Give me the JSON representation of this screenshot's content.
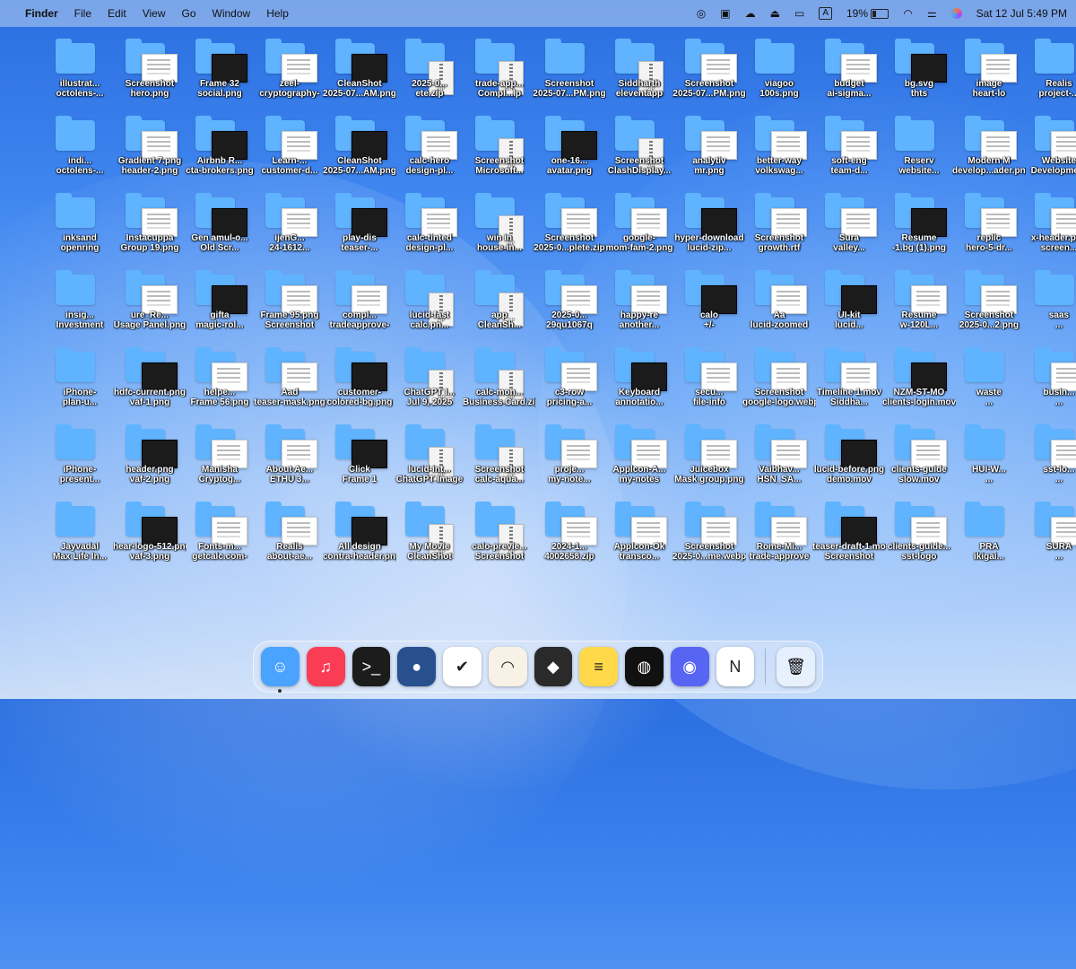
{
  "menubar": {
    "apple": "",
    "app": "Finder",
    "items": [
      "File",
      "Edit",
      "View",
      "Go",
      "Window",
      "Help"
    ],
    "battery": "19%",
    "input": "A",
    "datetime": "Sat 12 Jul  5:49 PM"
  },
  "desktop": {
    "items": [
      {
        "t": "folder",
        "l": "illustrat...",
        "l2": "octolens-..."
      },
      {
        "t": "doc",
        "l": "Screenshot",
        "l2": "hero.png"
      },
      {
        "t": "dark",
        "l": "Frame 32",
        "l2": "social.png"
      },
      {
        "t": "doc",
        "l": "zeel-",
        "l2": "cryptography-"
      },
      {
        "t": "dark",
        "l": "CleanShot",
        "l2": "2025-07...AM.png"
      },
      {
        "t": "zip",
        "l": "2025-0...",
        "l2": "ete.zip"
      },
      {
        "t": "zip",
        "l": "trade-app...",
        "l2": "Compl...ip"
      },
      {
        "t": "folder",
        "l": "Screenshot",
        "l2": "2025-07...PM.png"
      },
      {
        "t": "zip",
        "l": "Siddharth",
        "l2": "eleventapp"
      },
      {
        "t": "doc",
        "l": "Screenshot",
        "l2": "2025-07...PM.png"
      },
      {
        "t": "folder",
        "l": "viagoo",
        "l2": "100s.png"
      },
      {
        "t": "doc",
        "l": "budget",
        "l2": "ai-sigma..."
      },
      {
        "t": "dark",
        "l": "bg.svg",
        "l2": "thts"
      },
      {
        "t": "doc",
        "l": "image",
        "l2": "heart-lo"
      },
      {
        "t": "folder",
        "l": "Realis",
        "l2": "project-..."
      },
      {
        "t": "folder",
        "l": "indi...",
        "l2": "octolens-..."
      },
      {
        "t": "doc",
        "l": "Gradient 7.png",
        "l2": "header-2.png"
      },
      {
        "t": "dark",
        "l": "Airbnb R...",
        "l2": "cta-brokers.png"
      },
      {
        "t": "doc",
        "l": "Learn-...",
        "l2": "customer-d..."
      },
      {
        "t": "dark",
        "l": "CleanShot",
        "l2": "2025-07...AM.png"
      },
      {
        "t": "doc",
        "l": "calc-hero",
        "l2": "design-pl..."
      },
      {
        "t": "zip",
        "l": "Screenshot",
        "l2": "Microsoft..."
      },
      {
        "t": "dark",
        "l": "one-16...",
        "l2": "avatar.png"
      },
      {
        "t": "zip",
        "l": "Screenshot",
        "l2": "ClashDisplay..."
      },
      {
        "t": "doc",
        "l": "analytiv",
        "l2": "mr.png"
      },
      {
        "t": "doc",
        "l": "better-way",
        "l2": "volkswag..."
      },
      {
        "t": "doc",
        "l": "soft-eng",
        "l2": "team-d..."
      },
      {
        "t": "folder",
        "l": "Reserv",
        "l2": "website..."
      },
      {
        "t": "doc",
        "l": "Modern M",
        "l2": "develop...ader.png"
      },
      {
        "t": "doc",
        "l": "Website",
        "l2": "Development"
      },
      {
        "t": "folder",
        "l": "inksand",
        "l2": "openring"
      },
      {
        "t": "doc",
        "l": "Instacuppa",
        "l2": "Group 19.png"
      },
      {
        "t": "dark",
        "l": "Gen amul-o...",
        "l2": "Old Scr..."
      },
      {
        "t": "doc",
        "l": "ijenG...",
        "l2": "24-1612..."
      },
      {
        "t": "dark",
        "l": "play-dis",
        "l2": "teaser-..."
      },
      {
        "t": "doc",
        "l": "calc-tinted",
        "l2": "design-pl..."
      },
      {
        "t": "zip",
        "l": "win in",
        "l2": "house-in..."
      },
      {
        "t": "doc",
        "l": "Screenshot",
        "l2": "2025-0...plete.zip"
      },
      {
        "t": "doc",
        "l": "google-",
        "l2": "mom-fam-2.png"
      },
      {
        "t": "dark",
        "l": "hyper-download",
        "l2": "lucid-zip..."
      },
      {
        "t": "doc",
        "l": "Screenshot",
        "l2": "growth.rtf"
      },
      {
        "t": "doc",
        "l": "Sura",
        "l2": "valley..."
      },
      {
        "t": "dark",
        "l": "Resume",
        "l2": "-1.bg (1).png"
      },
      {
        "t": "doc",
        "l": "replic",
        "l2": "hero-5-dr..."
      },
      {
        "t": "doc",
        "l": "x-header.png",
        "l2": "screen..."
      },
      {
        "t": "folder",
        "l": "insig...",
        "l2": "Investment"
      },
      {
        "t": "doc",
        "l": "ure_Re...",
        "l2": "Usage Panel.png"
      },
      {
        "t": "dark",
        "l": "gifta",
        "l2": "magic-rol..."
      },
      {
        "t": "doc",
        "l": "Frame 95.png",
        "l2": "Screenshot"
      },
      {
        "t": "doc",
        "l": "compl...",
        "l2": "tradeapprove-"
      },
      {
        "t": "zip",
        "l": "lucid-fast",
        "l2": "calc.pn..."
      },
      {
        "t": "zip",
        "l": "app",
        "l2": "CleanSh..."
      },
      {
        "t": "doc",
        "l": "2025-0...",
        "l2": "29qu1067q"
      },
      {
        "t": "doc",
        "l": "happy-re",
        "l2": "another..."
      },
      {
        "t": "dark",
        "l": "calo",
        "l2": "+/-"
      },
      {
        "t": "doc",
        "l": "Aa",
        "l2": "lucid-zoomed"
      },
      {
        "t": "dark",
        "l": "UI-kit",
        "l2": "lucid..."
      },
      {
        "t": "doc",
        "l": "Resume",
        "l2": "w-120L..."
      },
      {
        "t": "doc",
        "l": "Screenshot",
        "l2": "2025-0...2.png"
      },
      {
        "t": "folder",
        "l": "saas",
        "l2": "..."
      },
      {
        "t": "folder",
        "l": "iPhone-",
        "l2": "plan-u..."
      },
      {
        "t": "dark",
        "l": "hdfc-current.png",
        "l2": "vaf-1.png"
      },
      {
        "t": "doc",
        "l": "helpe...",
        "l2": "Frame 56.png"
      },
      {
        "t": "doc",
        "l": "Aad",
        "l2": "teaser-mask.png"
      },
      {
        "t": "dark",
        "l": "customer-",
        "l2": "colored-bg.png"
      },
      {
        "t": "zip",
        "l": "ChatGPT I...",
        "l2": "Jul 9, 2025"
      },
      {
        "t": "zip",
        "l": "calc-mon...",
        "l2": "Business Card.zip"
      },
      {
        "t": "doc",
        "l": "c3-row",
        "l2": "pricing-a..."
      },
      {
        "t": "dark",
        "l": "Keyboard",
        "l2": "annotatio..."
      },
      {
        "t": "doc",
        "l": "secu...",
        "l2": "file-info"
      },
      {
        "t": "doc",
        "l": "Screenshot",
        "l2": "google-logo.webp"
      },
      {
        "t": "doc",
        "l": "Timeline 1.mov",
        "l2": "Siddha..."
      },
      {
        "t": "dark",
        "l": "NZM-ST-MO",
        "l2": "clients-login.mov"
      },
      {
        "t": "folder",
        "l": "waste",
        "l2": "..."
      },
      {
        "t": "doc",
        "l": "busin...",
        "l2": "..."
      },
      {
        "t": "folder",
        "l": "iPhone-",
        "l2": "present..."
      },
      {
        "t": "dark",
        "l": "header.png",
        "l2": "vaf-2.png"
      },
      {
        "t": "doc",
        "l": "Manisha",
        "l2": "Cryptog..."
      },
      {
        "t": "doc",
        "l": "About Ae...",
        "l2": "ETHU 3..."
      },
      {
        "t": "dark",
        "l": "Click",
        "l2": "Frame 1"
      },
      {
        "t": "zip",
        "l": "lucid-int...",
        "l2": "ChatGPT Image"
      },
      {
        "t": "zip",
        "l": "Screenshot",
        "l2": "calc-aqua..."
      },
      {
        "t": "doc",
        "l": "proje...",
        "l2": "my-note..."
      },
      {
        "t": "doc",
        "l": "Applcon-A...",
        "l2": "my-notes"
      },
      {
        "t": "doc",
        "l": "Juicebox",
        "l2": "Mask group.png"
      },
      {
        "t": "doc",
        "l": "Vaibhav...",
        "l2": "HSN_SA..."
      },
      {
        "t": "dark",
        "l": "lucid-before.png",
        "l2": "demo.mov"
      },
      {
        "t": "doc",
        "l": "clients-guide",
        "l2": "slow.mov"
      },
      {
        "t": "folder",
        "l": "HUI-W...",
        "l2": "..."
      },
      {
        "t": "doc",
        "l": "sst-lo...",
        "l2": "..."
      },
      {
        "t": "folder",
        "l": "Jayvadal",
        "l2": "Max Life In..."
      },
      {
        "t": "dark",
        "l": "hear-logo-512.png",
        "l2": "vaf-3.png"
      },
      {
        "t": "doc",
        "l": "Fonts-m...",
        "l2": "getcalc.com-"
      },
      {
        "t": "doc",
        "l": "Realis",
        "l2": "about-ae..."
      },
      {
        "t": "dark",
        "l": "All design",
        "l2": "contra-header.png"
      },
      {
        "t": "zip",
        "l": "My Movie",
        "l2": "CleanShot"
      },
      {
        "t": "zip",
        "l": "calo-previe...",
        "l2": "Screenshot"
      },
      {
        "t": "doc",
        "l": "2024-1...",
        "l2": "4002658.zip"
      },
      {
        "t": "doc",
        "l": "Applcon-Ok",
        "l2": "transco..."
      },
      {
        "t": "doc",
        "l": "Screenshot",
        "l2": "2025-0...me.webp"
      },
      {
        "t": "doc",
        "l": "Rome-Mi...",
        "l2": "trade-approve"
      },
      {
        "t": "dark",
        "l": "teaser-draft-1.mov",
        "l2": "Screenshot"
      },
      {
        "t": "doc",
        "l": "clients-guide...",
        "l2": "sst-logo"
      },
      {
        "t": "folder",
        "l": "PRA",
        "l2": "ikigai..."
      },
      {
        "t": "doc",
        "l": "SURA",
        "l2": "..."
      }
    ]
  },
  "dock": {
    "apps": [
      {
        "name": "finder-icon",
        "glyph": "☺",
        "bg": "#4aa3ff",
        "running": true
      },
      {
        "name": "music-icon",
        "glyph": "♫",
        "bg": "#fb3c55",
        "running": false
      },
      {
        "name": "terminal-icon",
        "glyph": ">_",
        "bg": "#1c1c1c",
        "running": false
      },
      {
        "name": "ghost-app-icon",
        "glyph": "●",
        "bg": "#28508f",
        "running": false
      },
      {
        "name": "tasks-check-icon",
        "glyph": "✔",
        "bg": "#ffffff",
        "running": false
      },
      {
        "name": "arc-browser-icon",
        "glyph": "◠",
        "bg": "#f7f1e6",
        "running": false
      },
      {
        "name": "cube-app-icon",
        "glyph": "◆",
        "bg": "#2a2a2a",
        "running": false
      },
      {
        "name": "notes-icon",
        "glyph": "≡",
        "bg": "#ffd94a",
        "running": false
      },
      {
        "name": "linear-icon",
        "glyph": "◍",
        "bg": "#111111",
        "running": false
      },
      {
        "name": "discord-icon",
        "glyph": "◉",
        "bg": "#5865f2",
        "running": false
      },
      {
        "name": "notion-icon",
        "glyph": "N",
        "bg": "#ffffff",
        "running": false
      }
    ],
    "trash": {
      "name": "trash-icon",
      "glyph": "🗑"
    }
  }
}
